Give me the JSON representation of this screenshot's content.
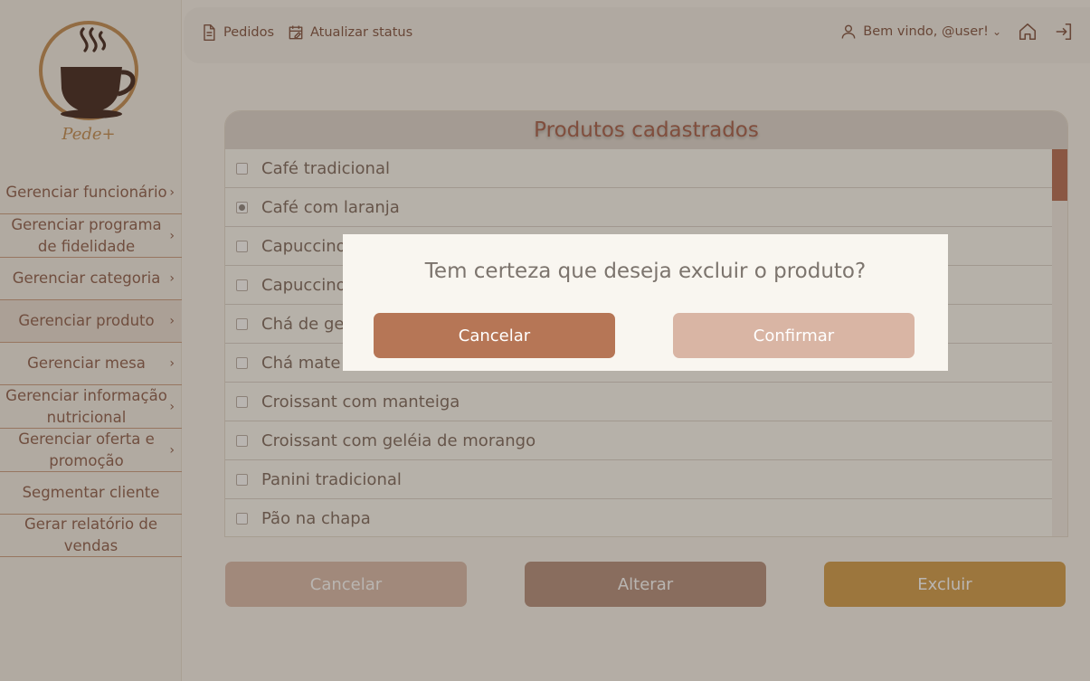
{
  "brand": {
    "name": "Pede+"
  },
  "sidebar": {
    "items": [
      {
        "label": "Gerenciar funcionário",
        "chevron": true
      },
      {
        "label": "Gerenciar programa de fidelidade",
        "chevron": true
      },
      {
        "label": "Gerenciar categoria",
        "chevron": true
      },
      {
        "label": "Gerenciar produto",
        "chevron": true,
        "active": true
      },
      {
        "label": "Gerenciar mesa",
        "chevron": true
      },
      {
        "label": "Gerenciar informação nutricional",
        "chevron": true
      },
      {
        "label": "Gerenciar oferta e promoção",
        "chevron": true
      },
      {
        "label": "Segmentar cliente",
        "chevron": false
      },
      {
        "label": "Gerar relatório de vendas",
        "chevron": false
      }
    ]
  },
  "header": {
    "orders_label": "Pedidos",
    "update_status_label": "Atualizar status",
    "welcome_label": "Bem vindo, @user!"
  },
  "panel": {
    "title": "Produtos cadastrados",
    "products": [
      {
        "name": "Café tradicional",
        "checked": false
      },
      {
        "name": "Café com laranja",
        "checked": true
      },
      {
        "name": "Capuccino",
        "checked": false
      },
      {
        "name": "Capuccino",
        "checked": false
      },
      {
        "name": "Chá de ge",
        "checked": false
      },
      {
        "name": "Chá mate",
        "checked": false
      },
      {
        "name": "Croissant com manteiga",
        "checked": false
      },
      {
        "name": "Croissant com geléia de morango",
        "checked": false
      },
      {
        "name": "Panini tradicional",
        "checked": false
      },
      {
        "name": "Pão na chapa",
        "checked": false
      }
    ]
  },
  "actions": {
    "cancel_label": "Cancelar",
    "alter_label": "Alterar",
    "delete_label": "Excluir"
  },
  "modal": {
    "message": "Tem certeza que deseja excluir o produto?",
    "cancel_label": "Cancelar",
    "confirm_label": "Confirmar"
  },
  "colors": {
    "accent": "#b67656",
    "delete": "#d19a45",
    "menu_text": "#8a5a48",
    "title_text": "#a45a45"
  }
}
